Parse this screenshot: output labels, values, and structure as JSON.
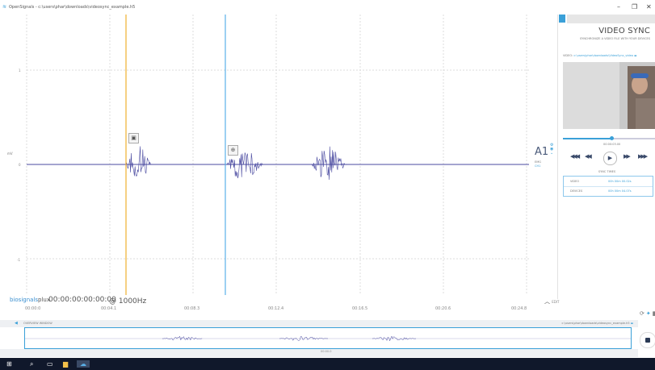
{
  "window": {
    "title": "OpenSignals - c:\\users\\phar\\downloads\\videosync_example.h5",
    "controls": [
      "–",
      "❐",
      "✕"
    ]
  },
  "plot": {
    "y_unit": "mV",
    "y_ticks": [
      "1",
      "0",
      "-1"
    ],
    "channel_label": "A1",
    "channel_sub1": "EMG",
    "channel_sub2": "CH1",
    "brand": "biosignalsplux",
    "brand_left": "biosignals",
    "brand_right": "plux",
    "timecode": "00:00:00:00:00:00",
    "sampling_rate": "@ 1000Hz",
    "collapse_label": "EDIT",
    "time_ticks": [
      "00:00:0",
      "00:04.1",
      "00:08.3",
      "00:12.4",
      "00:16.5",
      "00:20.6",
      "00:24.8"
    ]
  },
  "colors": {
    "signal": "#4a4aa0",
    "accent": "#3aa0d8",
    "cursor_orange": "#f0b030",
    "cursor_blue": "#5ab0e8"
  },
  "video_sync": {
    "title": "VIDEO SYNC",
    "subtitle": "SYNCHRONIZE A VIDEO FILE WITH YOUR DEVICES",
    "path_label": "VIDEO:",
    "path": "c:\\users\\phar\\downloads\\VideoSync_video",
    "progress": 0.53,
    "time": "00:00:03.00",
    "sync_times_title": "SYNC TIMES",
    "rows": [
      {
        "label": "VIDEO",
        "value": "00h 00m 00.02s"
      },
      {
        "label": "DEVICES",
        "value": "00h 00m 04.07s"
      }
    ]
  },
  "overview": {
    "label": "OVERVIEW WINDOW",
    "path": "c:\\users\\phar\\downloads\\videosync_example.h5",
    "time": "00:00.0"
  }
}
